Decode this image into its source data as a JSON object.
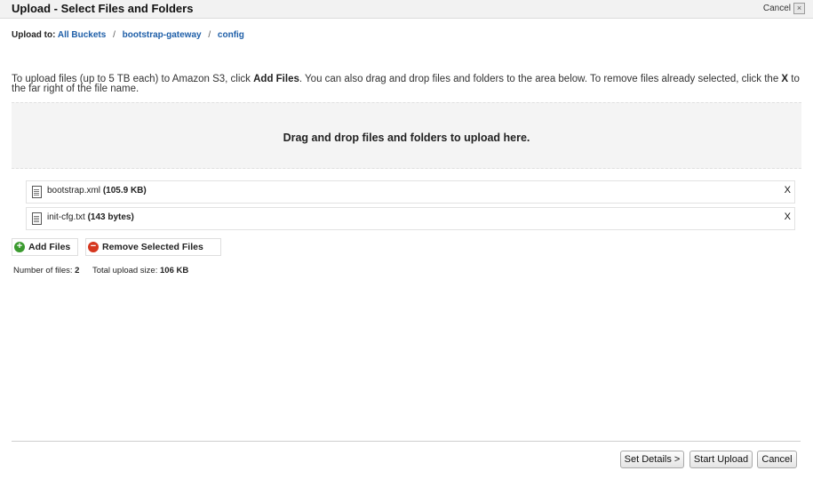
{
  "dialog": {
    "title": "Upload - Select Files and Folders",
    "cancel_link": "Cancel",
    "close_glyph": "×"
  },
  "breadcrumb": {
    "label": "Upload to:",
    "items": [
      "All Buckets",
      "bootstrap-gateway",
      "config"
    ],
    "separator": "/"
  },
  "instructions": {
    "part1": "To upload files (up to 5 TB each) to Amazon S3, click ",
    "bold1": "Add Files",
    "part2": ". You can also drag and drop files and folders to the area below. To remove files already selected, click the ",
    "bold2": "X",
    "part3": " to the far right of the file name."
  },
  "dropzone": {
    "text": "Drag and drop files and folders to upload here."
  },
  "files": [
    {
      "name": "bootstrap.xml",
      "size": "(105.9 KB)",
      "remove": "X",
      "icon": "file-icon"
    },
    {
      "name": "init-cfg.txt",
      "size": "(143 bytes)",
      "remove": "X",
      "icon": "file-icon"
    }
  ],
  "actions": {
    "add_files": "Add Files",
    "add_icon": "+",
    "remove_selected": "Remove Selected Files",
    "remove_icon": "−"
  },
  "summary": {
    "count_label": "Number of files:",
    "count_value": "2",
    "size_label": "Total upload size:",
    "size_value": "106 KB"
  },
  "footer": {
    "set_details": "Set Details >",
    "start_upload": "Start Upload",
    "cancel": "Cancel"
  },
  "colors": {
    "link": "#1f5fa8",
    "add_icon": "#3a9a2e",
    "remove_icon": "#d6371f"
  }
}
